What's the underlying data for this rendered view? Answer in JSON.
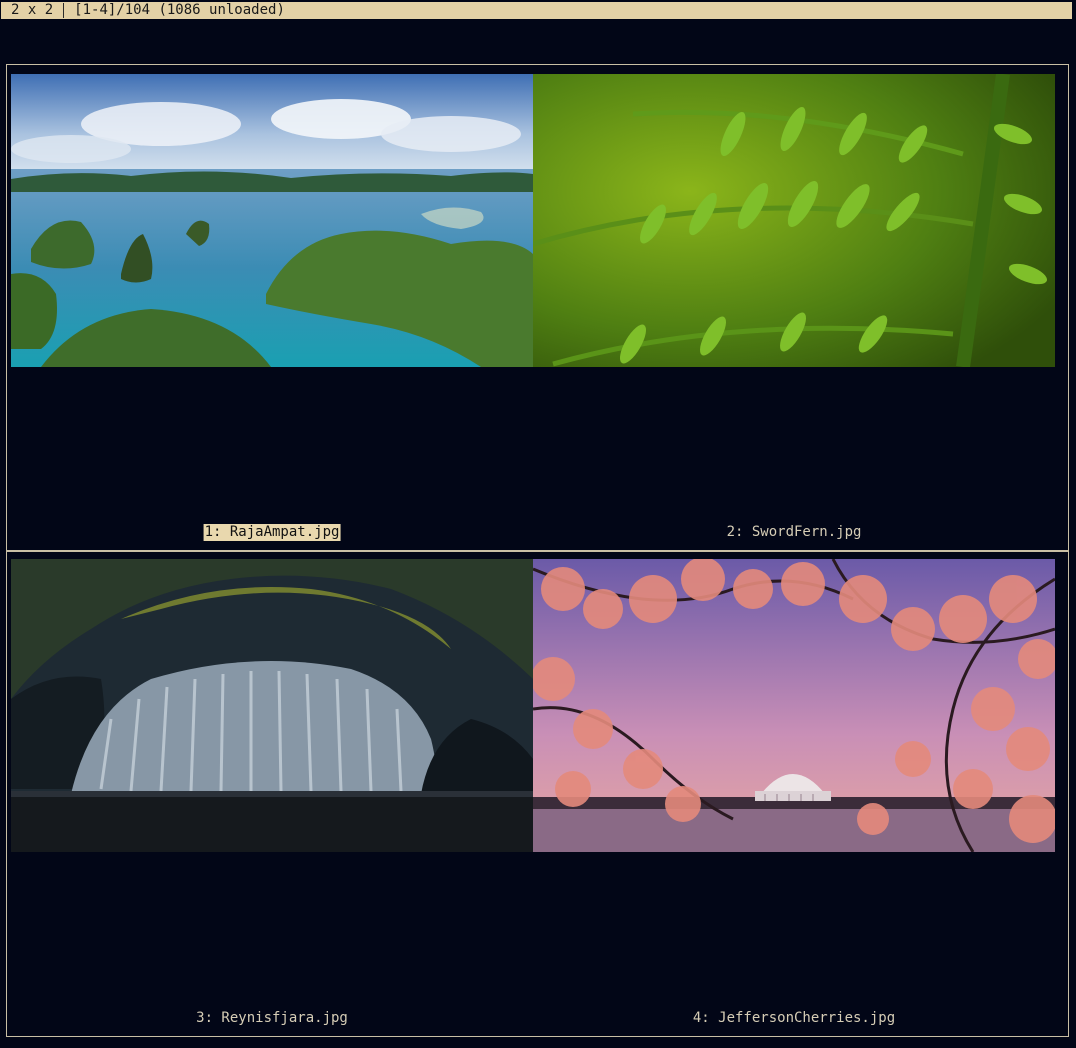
{
  "status": {
    "layout": "2 x 2",
    "range": "[1-4]/104 (1086 unloaded)"
  },
  "colors": {
    "background": "#020617",
    "statusbar": "#e3d1a6",
    "border": "#c9bfa5",
    "caption_text": "#d6cdb6",
    "selected_caption_bg": "#e9d8ae"
  },
  "thumbnails": [
    {
      "caption": "1: RajaAmpat.jpg",
      "selected": true,
      "icon": "tropical-islands-image"
    },
    {
      "caption": "2: SwordFern.jpg",
      "selected": false,
      "icon": "fern-leaf-image"
    },
    {
      "caption": "3: Reynisfjara.jpg",
      "selected": false,
      "icon": "basalt-cave-image"
    },
    {
      "caption": "4: JeffersonCherries.jpg",
      "selected": false,
      "icon": "cherry-blossom-image"
    }
  ]
}
